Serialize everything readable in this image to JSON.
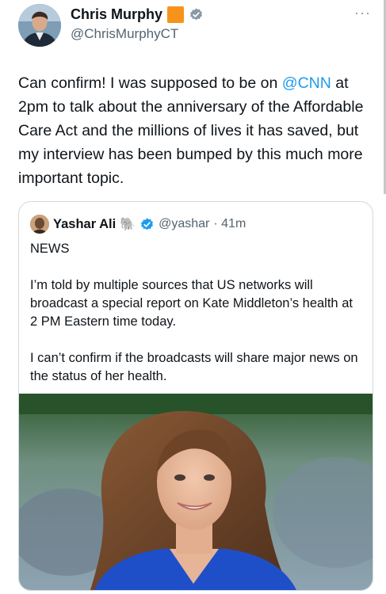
{
  "author": {
    "name": "Chris Murphy",
    "handle": "@ChrisMurphyCT"
  },
  "tweet": {
    "text_before": "Can confirm! I was supposed to be on ",
    "mention": "@CNN",
    "text_after": " at 2pm to talk about the anniversary of the Affordable Care Act and the millions of lives it has saved, but my interview has been bumped by this much more important topic."
  },
  "more_menu": "···",
  "quoted": {
    "name": "Yashar Ali",
    "emoji": "🐘",
    "handle": "@yashar",
    "time": "· 41m",
    "text": "NEWS\n\nI’m told by multiple sources that US networks will broadcast a special report on Kate Middleton’s health at 2 PM Eastern time today.\n\nI can’t confirm if the broadcasts will share major news on the status of her health."
  },
  "colors": {
    "link": "#1d9bf0",
    "verified": "#1d9bf0",
    "affiliate_badge": "#f7931a",
    "secondary_text": "#536471",
    "border": "#cfd9de"
  },
  "icons": [
    "avatar",
    "affiliate-badge-icon",
    "verified-badge-icon",
    "more-options-icon",
    "elephant-emoji-icon"
  ]
}
